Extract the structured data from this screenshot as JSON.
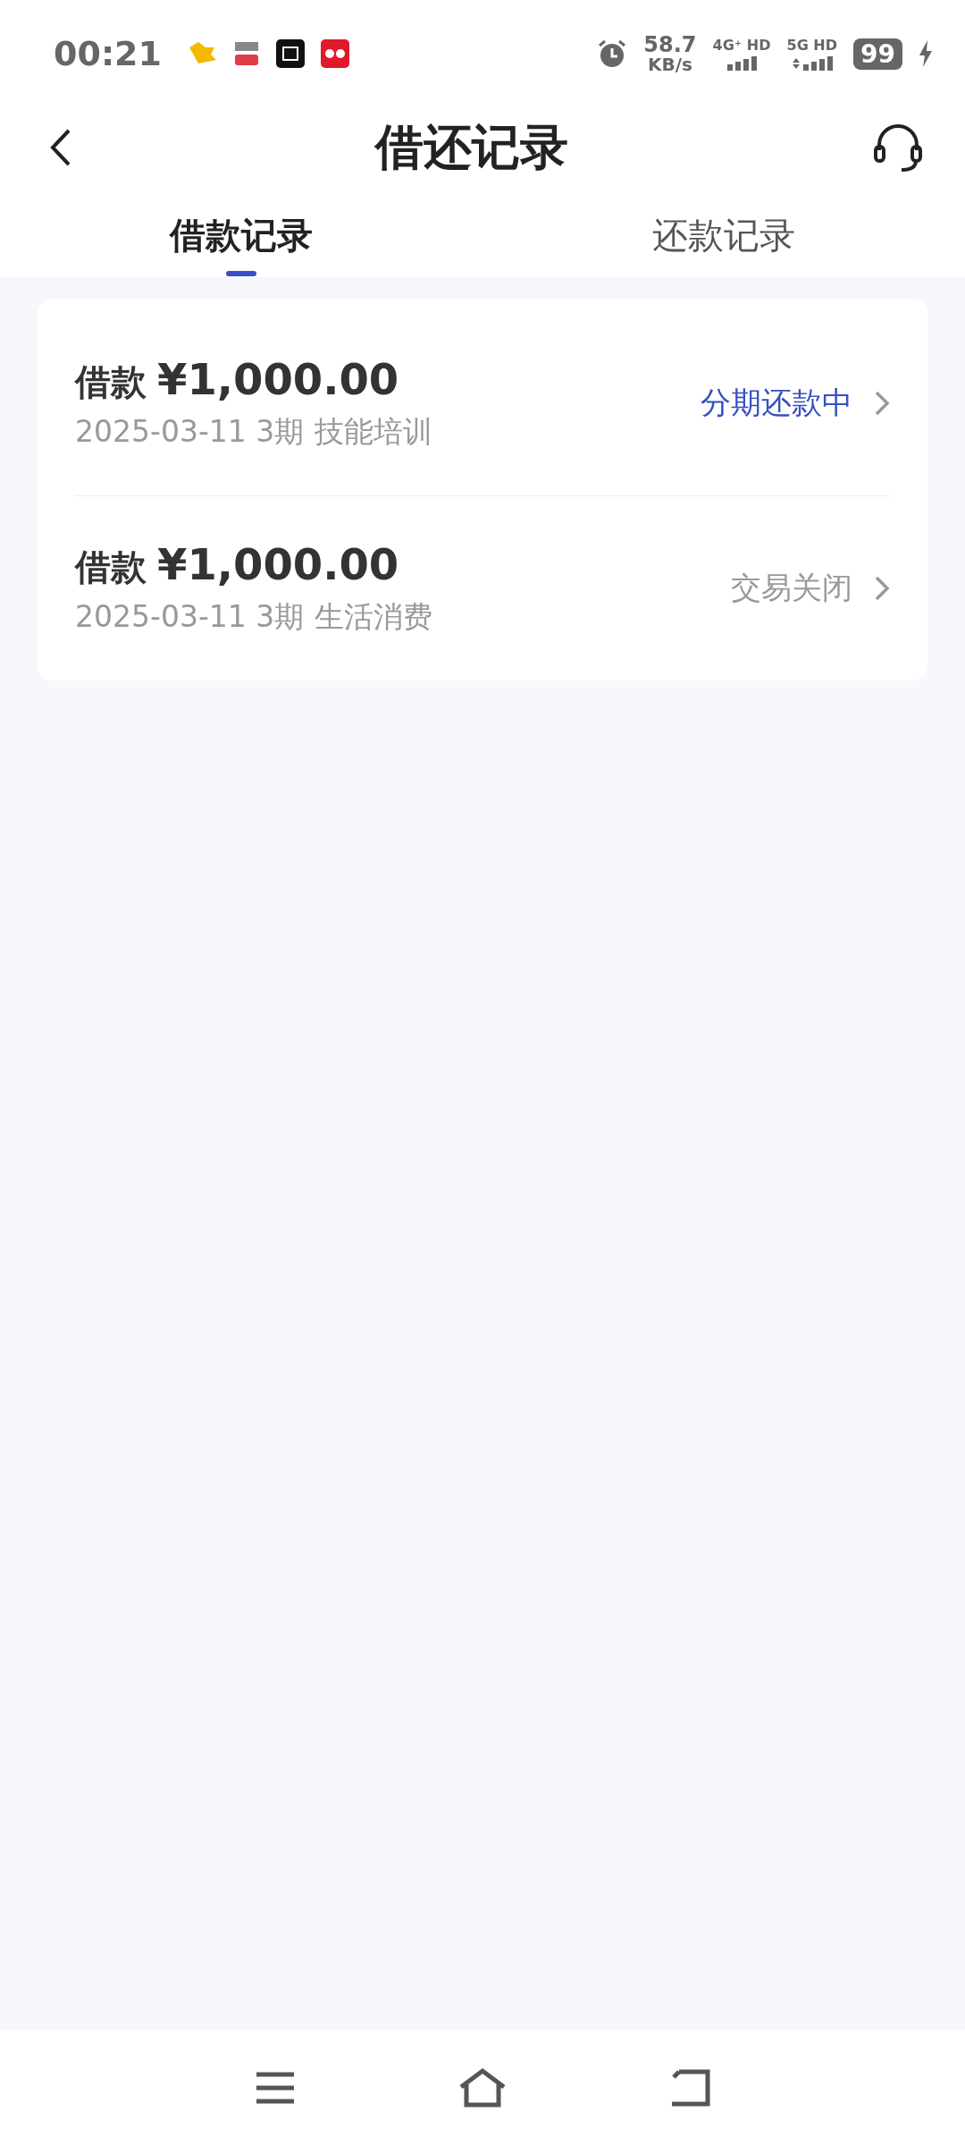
{
  "status_bar": {
    "time": "00:21",
    "speed": "58.7",
    "speed_unit": "KB/s",
    "network_1": "4G⁺ HD",
    "network_2": "5G HD",
    "battery": "99",
    "charging": true
  },
  "header": {
    "title": "借还记录"
  },
  "tabs": [
    {
      "label": "借款记录",
      "selected": true
    },
    {
      "label": "还款记录",
      "selected": false
    }
  ],
  "records": [
    {
      "label": "借款",
      "amount": "¥1,000.00",
      "date_term": "2025-03-11 3期",
      "purpose": "技能培训",
      "status": "分期还款中",
      "color": "#3550c0"
    },
    {
      "label": "借款",
      "amount": "¥1,000.00",
      "date_term": "2025-03-11 3期",
      "purpose": "生活消费",
      "status": "交易关闭",
      "color": "#999999"
    }
  ]
}
